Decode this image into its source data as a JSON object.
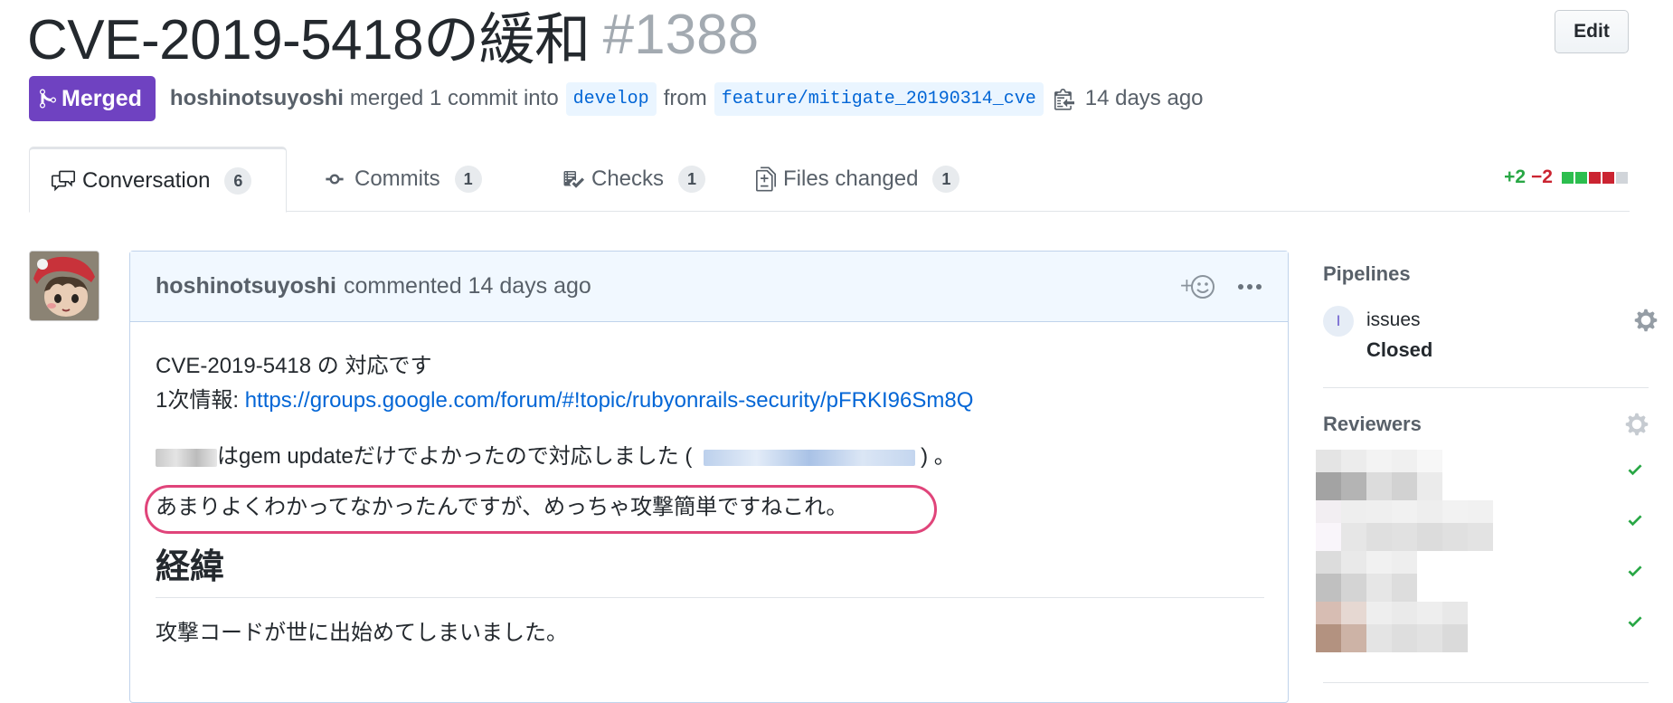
{
  "header": {
    "title": "CVE-2019-5418の緩和",
    "number": "#1388",
    "edit_label": "Edit"
  },
  "meta": {
    "status": "Merged",
    "author": "hoshinotsuyoshi",
    "action_text": "merged 1 commit into",
    "base_branch": "develop",
    "from_text": "from",
    "head_branch": "feature/mitigate_20190314_cve",
    "time": "14 days ago",
    "status_color": "#6f42c1"
  },
  "tabs": [
    {
      "label": "Conversation",
      "count": "6",
      "icon": "comment-discussion-icon"
    },
    {
      "label": "Commits",
      "count": "1",
      "icon": "git-commit-icon"
    },
    {
      "label": "Checks",
      "count": "1",
      "icon": "checklist-icon"
    },
    {
      "label": "Files changed",
      "count": "1",
      "icon": "file-diff-icon"
    }
  ],
  "diffstat": {
    "additions": "+2",
    "deletions": "−2"
  },
  "comment": {
    "author": "hoshinotsuyoshi",
    "action": "commented 14 days ago",
    "line1": "CVE-2019-5418 の 対応です",
    "line2_prefix": "1次情報: ",
    "link": "https://groups.google.com/forum/#!topic/rubyonrails-security/pFRKI96Sm8Q",
    "line3_middle": "はgem updateだけでよかったので対応しました (",
    "line3_suffix": ") 。",
    "highlight": "あまりよくわかってなかったんですが、めっちゃ攻撃簡単ですねこれ。",
    "heading": "経緯",
    "para": "攻撃コードが世に出始めてしまいました。"
  },
  "sidebar": {
    "pipelines_heading": "Pipelines",
    "pipeline_badge": "I",
    "pipeline_name": "issues",
    "pipeline_status": "Closed",
    "reviewers_heading": "Reviewers"
  }
}
